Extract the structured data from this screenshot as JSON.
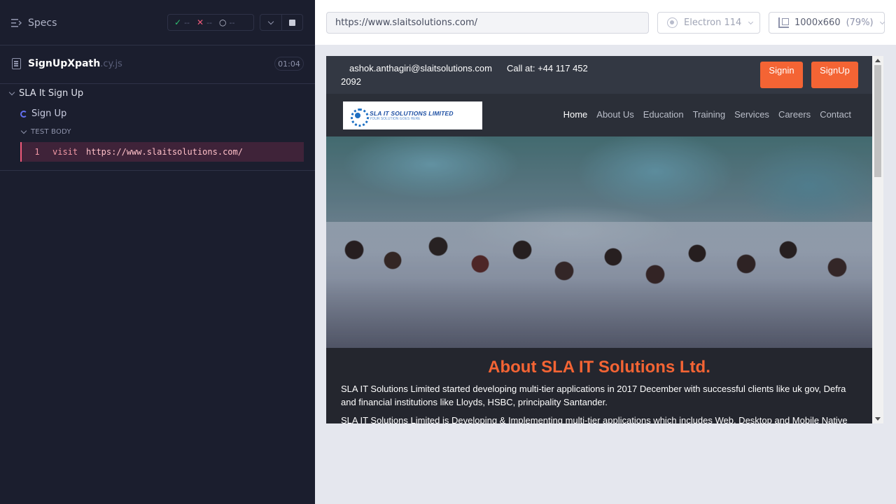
{
  "runner": {
    "specs_label": "Specs",
    "stats": {
      "passed": "--",
      "failed": "--",
      "pending": "--"
    },
    "spec_file": {
      "name": "SignUpXpath",
      "ext": ".cy.js",
      "duration": "01:04"
    },
    "suite_title": "SLA It Sign Up",
    "test_title": "Sign Up",
    "section_label": "TEST BODY",
    "command": {
      "number": "1",
      "name": "visit",
      "message": "https://www.slaitsolutions.com/"
    }
  },
  "aut": {
    "url": "https://www.slaitsolutions.com/",
    "browser": "Electron 114",
    "viewport": "1000x660",
    "viewport_scale": "(79%)"
  },
  "site": {
    "email": "ashok.anthagiri@slaitsolutions.com",
    "phone_part1": "Call at: +44 117 452",
    "phone_part2": "2092",
    "signin_label": "Signin",
    "signup_label": "SignUp",
    "logo_name": "SLA IT SOLUTIONS LIMITED",
    "logo_tagline": "YOUR SOLUTION GOES HERE",
    "nav": [
      "Home",
      "About Us",
      "Education",
      "Training",
      "Services",
      "Careers",
      "Contact"
    ],
    "about_title": "About SLA IT Solutions Ltd.",
    "about_p1": "SLA IT Solutions Limited started developing multi-tier applications in 2017 December with successful clients like uk gov, Defra and financial institutions like Lloyds, HSBC, principality Santander.",
    "about_p2": "SLA IT Solutions Limited is Developing & Implementing multi-tier applications which includes Web, Desktop and Mobile Native"
  },
  "colors": {
    "accent_orange": "#f46434",
    "runner_bg": "#1b1e2e",
    "command_bg": "#3f2339",
    "command_text": "#f49aa6"
  }
}
